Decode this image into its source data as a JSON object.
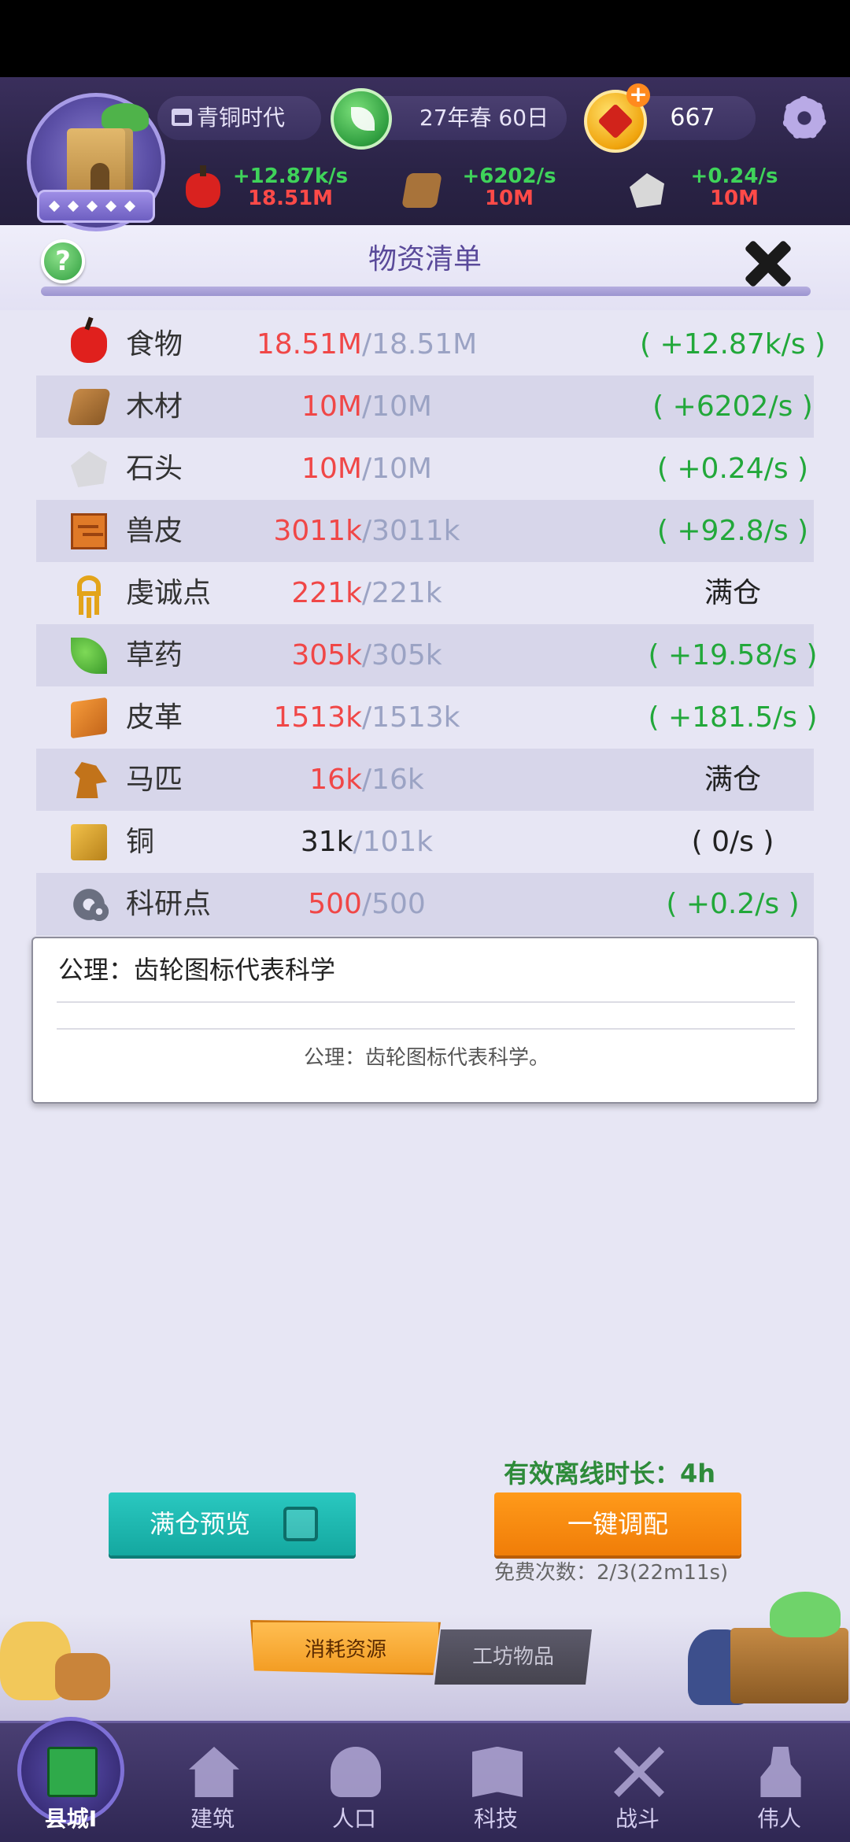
{
  "header": {
    "era": "青铜时代",
    "date": "27年春 60日",
    "coins": "667",
    "rates": [
      {
        "icon": "apple-icon",
        "rate": "+12.87k/s",
        "amount": "18.51M"
      },
      {
        "icon": "wood-icon",
        "rate": "+6202/s",
        "amount": "10M"
      },
      {
        "icon": "stone-icon",
        "rate": "+0.24/s",
        "amount": "10M"
      }
    ]
  },
  "panel": {
    "title": "物资清单",
    "resources": [
      {
        "icon": "apple-icon",
        "name": "食物",
        "current": "18.51M",
        "max": "/18.51M",
        "rate": "( +12.87k/s )"
      },
      {
        "icon": "wood-icon",
        "name": "木材",
        "current": "10M",
        "max": "/10M",
        "rate": "( +6202/s )"
      },
      {
        "icon": "stone-icon",
        "name": "石头",
        "current": "10M",
        "max": "/10M",
        "rate": "( +0.24/s )"
      },
      {
        "icon": "hide-icon",
        "name": "兽皮",
        "current": "3011k",
        "max": "/3011k",
        "rate": "( +92.8/s )"
      },
      {
        "icon": "ankh-icon",
        "name": "虔诚点",
        "current": "221k",
        "max": "/221k",
        "rate": "满仓"
      },
      {
        "icon": "herb-icon",
        "name": "草药",
        "current": "305k",
        "max": "/305k",
        "rate": "( +19.58/s )"
      },
      {
        "icon": "leather-icon",
        "name": "皮革",
        "current": "1513k",
        "max": "/1513k",
        "rate": "( +181.5/s )"
      },
      {
        "icon": "horse-icon",
        "name": "马匹",
        "current": "16k",
        "max": "/16k",
        "rate": "满仓"
      },
      {
        "icon": "copper-icon",
        "name": "铜",
        "current": "31k",
        "max": "/101k",
        "rate": "( 0/s )"
      },
      {
        "icon": "gears-icon",
        "name": "科研点",
        "current": "500",
        "max": "/500",
        "rate": "( +0.2/s )"
      }
    ],
    "tooltip": {
      "title": "公理：齿轮图标代表科学",
      "description": "公理：齿轮图标代表科学。"
    },
    "offline_duration": "有效离线时长：4h",
    "full_preview_label": "满仓预览",
    "allocate_label": "一键调配",
    "free_count": "免费次数：2/3(22m11s)",
    "tabs": [
      "消耗资源",
      "工坊物品"
    ]
  },
  "nav": {
    "items": [
      {
        "label": "县城I",
        "icon": "castle-icon"
      },
      {
        "label": "建筑",
        "icon": "house-icon"
      },
      {
        "label": "人口",
        "icon": "person-icon"
      },
      {
        "label": "科技",
        "icon": "book-icon"
      },
      {
        "label": "战斗",
        "icon": "swords-icon"
      },
      {
        "label": "伟人",
        "icon": "statue-icon"
      }
    ]
  },
  "colors": {
    "full_text": "#f04747",
    "max_text": "#9ba3c4",
    "rate_green": "#22a83a",
    "teal_button": "#1ab8b0",
    "orange_button": "#f58a10"
  }
}
